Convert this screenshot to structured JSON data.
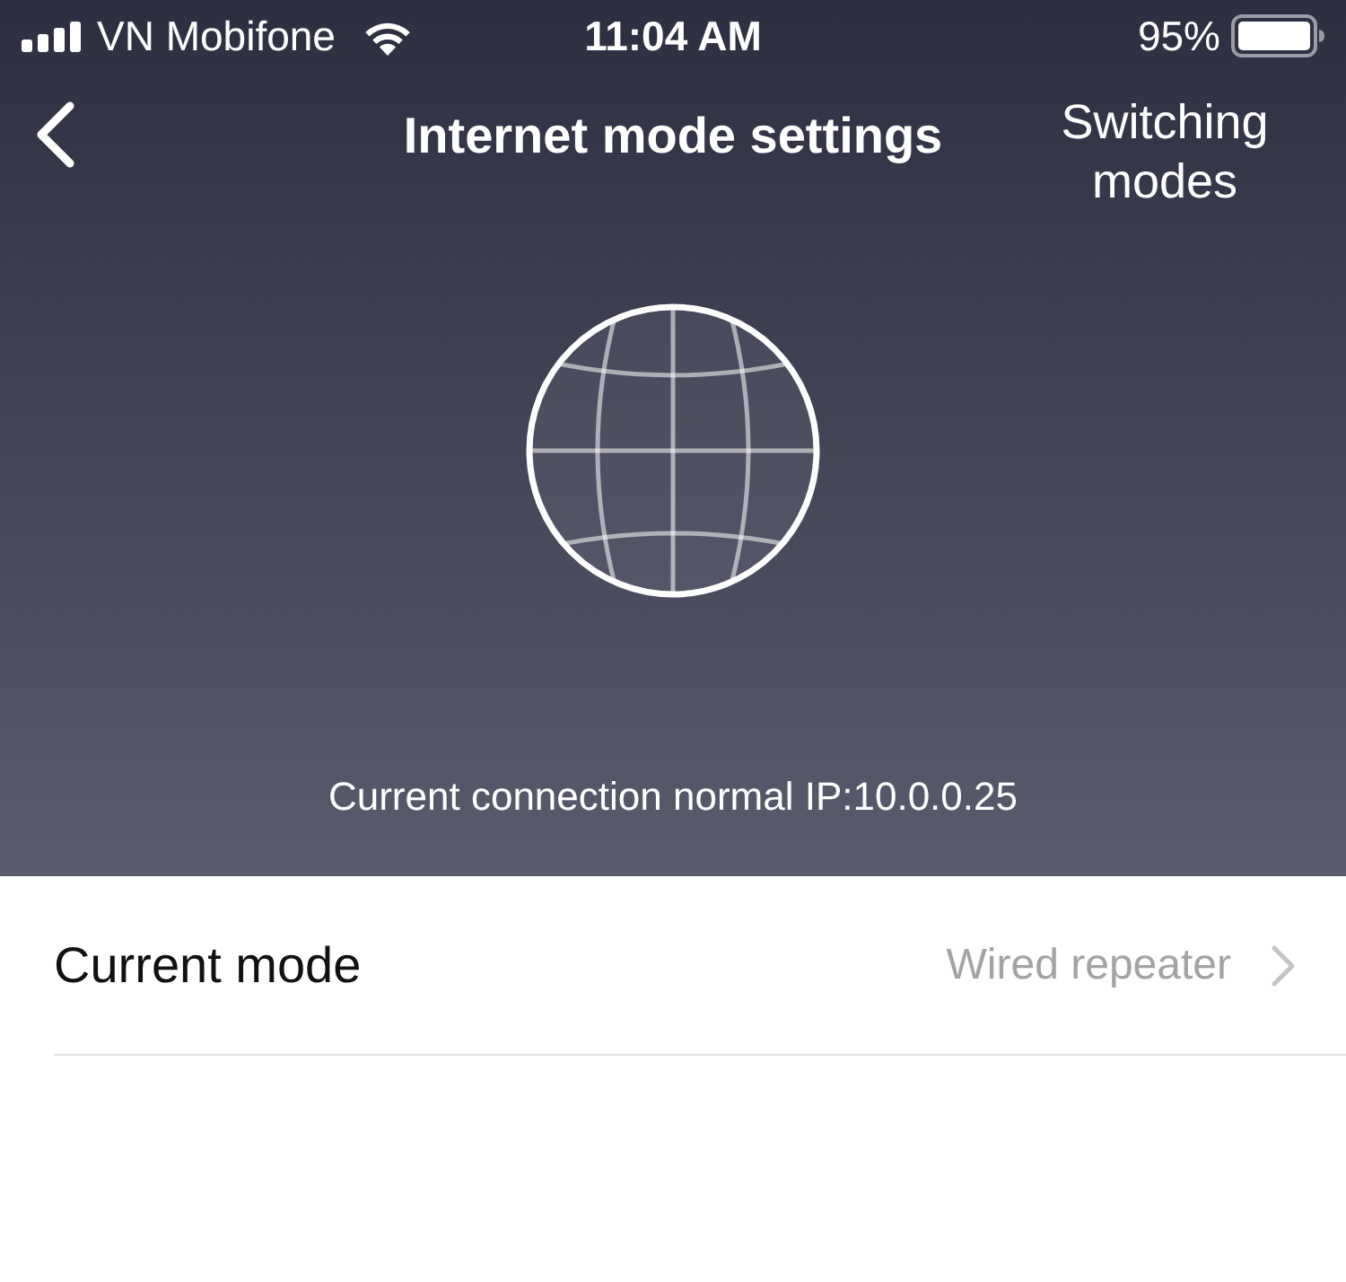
{
  "status_bar": {
    "carrier": "VN Mobifone",
    "time": "11:04 AM",
    "battery": "95%"
  },
  "nav": {
    "title": "Internet mode settings",
    "action": "Switching modes"
  },
  "connection": {
    "status": "Current connection normal IP:10.0.0.25"
  },
  "settings": [
    {
      "label": "Current mode",
      "value": "Wired repeater"
    }
  ]
}
